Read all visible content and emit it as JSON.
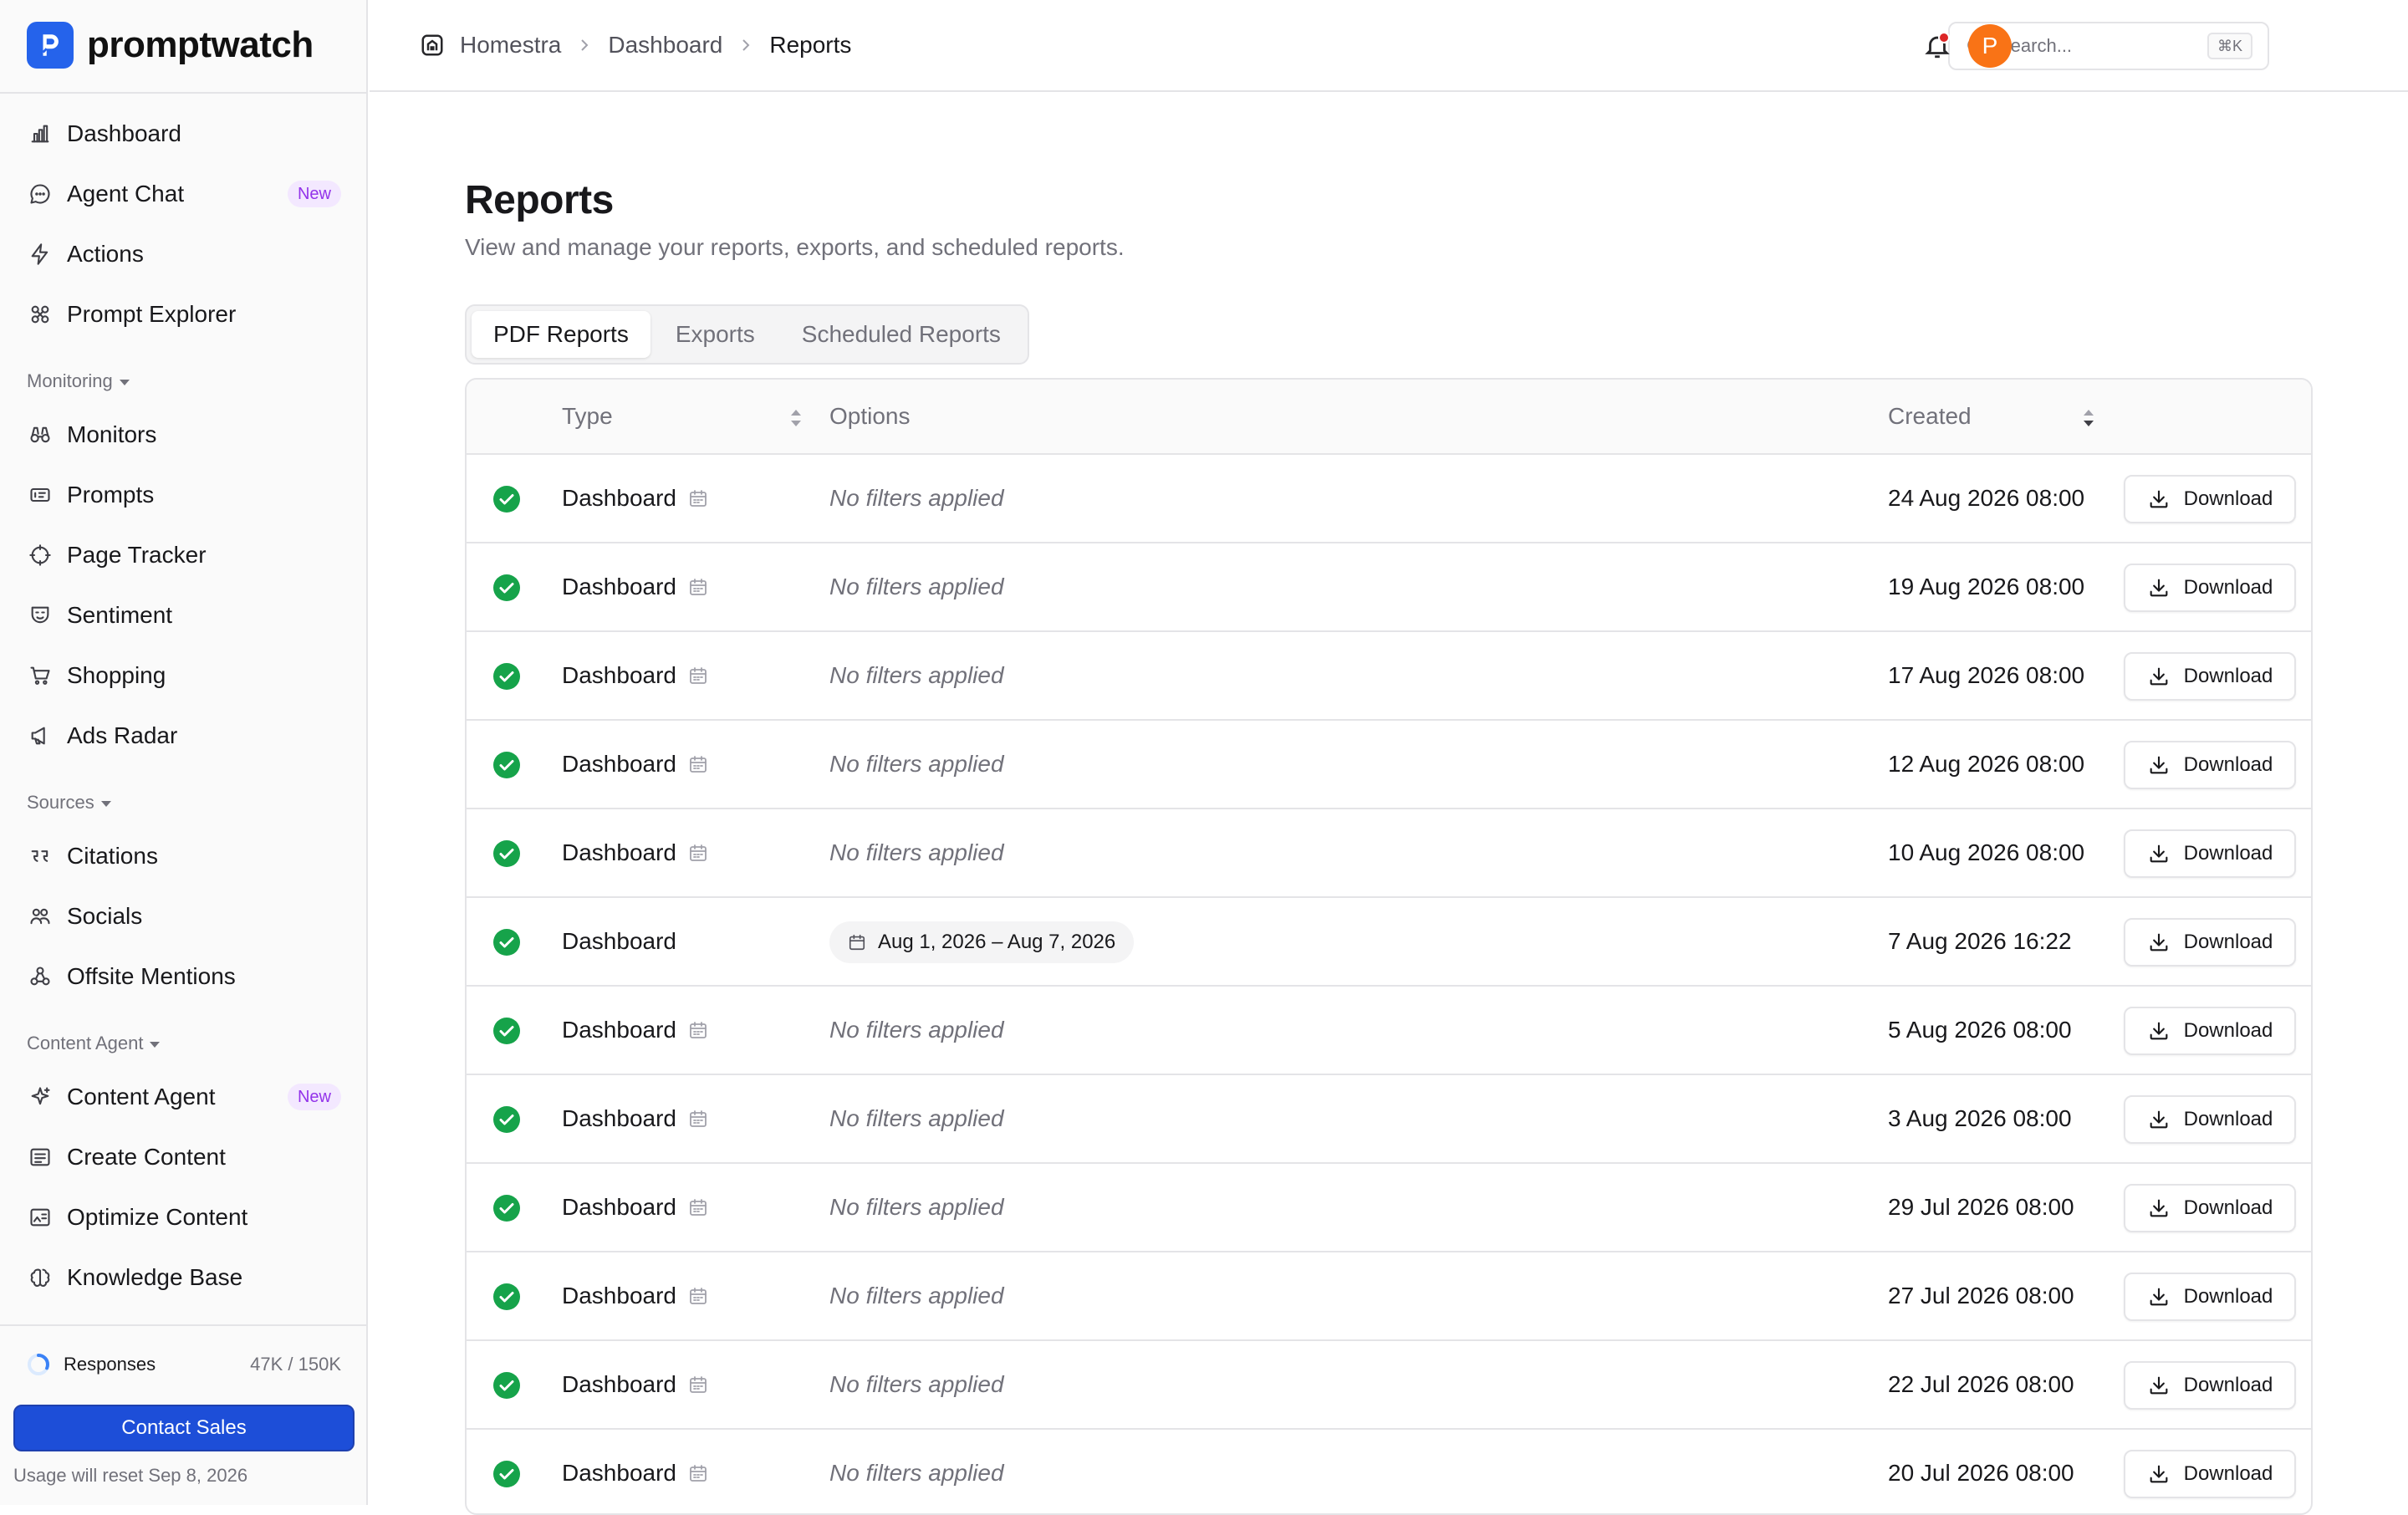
{
  "brand": {
    "name": "promptwatch",
    "accent": "#2563eb"
  },
  "sidebar": {
    "top_items": [
      {
        "label": "Dashboard",
        "icon": "bar-chart-icon"
      },
      {
        "label": "Agent Chat",
        "icon": "chat-bubble-icon",
        "badge": "New"
      },
      {
        "label": "Actions",
        "icon": "lightning-icon"
      },
      {
        "label": "Prompt Explorer",
        "icon": "explorer-icon"
      }
    ],
    "monitoring": {
      "title": "Monitoring",
      "items": [
        {
          "label": "Monitors",
          "icon": "binoculars-icon"
        },
        {
          "label": "Prompts",
          "icon": "prompt-icon"
        },
        {
          "label": "Page Tracker",
          "icon": "crosshair-icon"
        },
        {
          "label": "Sentiment",
          "icon": "mask-icon"
        },
        {
          "label": "Shopping",
          "icon": "cart-icon"
        },
        {
          "label": "Ads Radar",
          "icon": "megaphone-icon"
        }
      ]
    },
    "sources": {
      "title": "Sources",
      "items": [
        {
          "label": "Citations",
          "icon": "quote-icon"
        },
        {
          "label": "Socials",
          "icon": "users-icon"
        },
        {
          "label": "Offsite Mentions",
          "icon": "network-icon"
        }
      ]
    },
    "content_agent": {
      "title": "Content Agent",
      "items": [
        {
          "label": "Content Agent",
          "icon": "sparkle-icon",
          "badge": "New"
        },
        {
          "label": "Create Content",
          "icon": "document-lines-icon"
        },
        {
          "label": "Optimize Content",
          "icon": "image-text-icon"
        },
        {
          "label": "Knowledge Base",
          "icon": "brain-icon"
        }
      ]
    },
    "usage": {
      "label": "Responses",
      "value": "47K / 150K",
      "fraction": 0.313
    },
    "contact_label": "Contact Sales",
    "reset_text": "Usage will reset Sep 8, 2026"
  },
  "header": {
    "breadcrumb": [
      "Homestra",
      "Dashboard",
      "Reports"
    ],
    "search_placeholder": "Search...",
    "search_shortcut": "⌘K",
    "avatar_initial": "P"
  },
  "page": {
    "title": "Reports",
    "subtitle": "View and manage your reports, exports, and scheduled reports.",
    "tabs": [
      "PDF Reports",
      "Exports",
      "Scheduled Reports"
    ],
    "active_tab": 0
  },
  "table": {
    "columns": {
      "type": "Type",
      "options": "Options",
      "created": "Created"
    },
    "download_label": "Download",
    "rows": [
      {
        "type": "Dashboard",
        "scheduled": true,
        "options": "No filters applied",
        "created": "24 Aug 2026 08:00",
        "status": "completed"
      },
      {
        "type": "Dashboard",
        "scheduled": true,
        "options": "No filters applied",
        "created": "19 Aug 2026 08:00",
        "status": "completed"
      },
      {
        "type": "Dashboard",
        "scheduled": true,
        "options": "No filters applied",
        "created": "17 Aug 2026 08:00",
        "status": "completed"
      },
      {
        "type": "Dashboard",
        "scheduled": true,
        "options": "No filters applied",
        "created": "12 Aug 2026 08:00",
        "status": "completed"
      },
      {
        "type": "Dashboard",
        "scheduled": true,
        "options": "No filters applied",
        "created": "10 Aug 2026 08:00",
        "status": "completed"
      },
      {
        "type": "Dashboard",
        "scheduled": false,
        "options": "Aug 1, 2026 – Aug 7, 2026",
        "chip": true,
        "created": "7 Aug 2026 16:22",
        "status": "completed"
      },
      {
        "type": "Dashboard",
        "scheduled": true,
        "options": "No filters applied",
        "created": "5 Aug 2026 08:00",
        "status": "completed"
      },
      {
        "type": "Dashboard",
        "scheduled": true,
        "options": "No filters applied",
        "created": "3 Aug 2026 08:00",
        "status": "completed"
      },
      {
        "type": "Dashboard",
        "scheduled": true,
        "options": "No filters applied",
        "created": "29 Jul 2026 08:00",
        "status": "completed"
      },
      {
        "type": "Dashboard",
        "scheduled": true,
        "options": "No filters applied",
        "created": "27 Jul 2026 08:00",
        "status": "completed"
      },
      {
        "type": "Dashboard",
        "scheduled": true,
        "options": "No filters applied",
        "created": "22 Jul 2026 08:00",
        "status": "completed"
      },
      {
        "type": "Dashboard",
        "scheduled": true,
        "options": "No filters applied",
        "created": "20 Jul 2026 08:00",
        "status": "completed"
      }
    ]
  },
  "colors": {
    "success": "#16a34a",
    "contact_button": "#1d4ed8",
    "badge_text": "#9333ea",
    "avatar": "#f97316",
    "notification_dot": "#dc2626"
  }
}
